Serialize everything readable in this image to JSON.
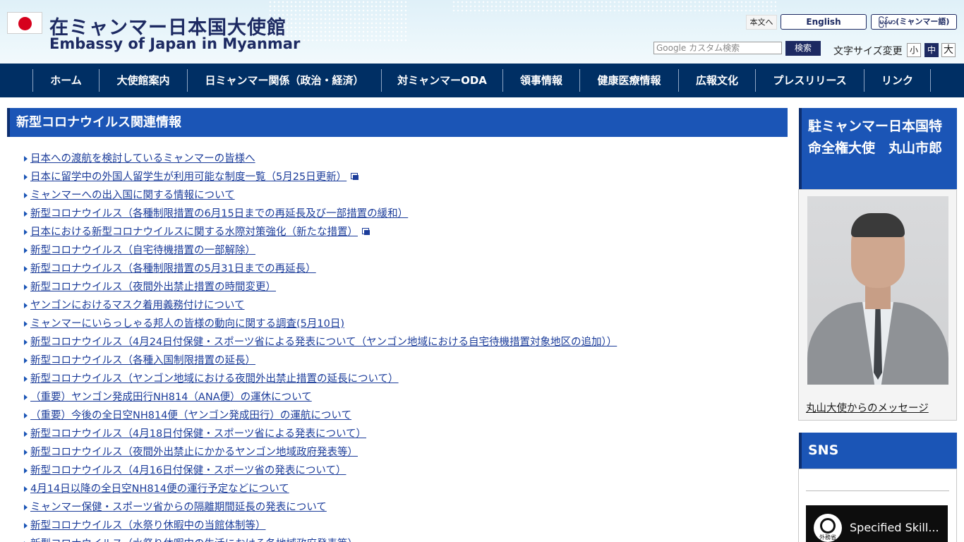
{
  "header": {
    "title_ja": "在ミャンマー日本国大使館",
    "title_en": "Embassy of Japan in Myanmar",
    "skip_link": "本文へ",
    "lang_en": "English",
    "lang_my": "မြန်မာ(ミャンマー語)",
    "search_placeholder": "Google カスタム検索",
    "search_button": "検索",
    "fontsize_label": "文字サイズ変更",
    "fontsize_small": "小",
    "fontsize_medium": "中",
    "fontsize_large": "大"
  },
  "nav": {
    "items": [
      {
        "label": "ホーム"
      },
      {
        "label": "大使館案内"
      },
      {
        "label": "日ミャンマー関係（政治・経済）"
      },
      {
        "label": "対ミャンマーODA"
      },
      {
        "label": "領事情報"
      },
      {
        "label": "健康医療情報"
      },
      {
        "label": "広報文化"
      },
      {
        "label": "プレスリリース"
      },
      {
        "label": "リンク"
      }
    ]
  },
  "main": {
    "heading": "新型コロナウイルス関連情報",
    "news": [
      {
        "text": "日本への渡航を検討しているミャンマーの皆様へ"
      },
      {
        "text": "日本に留学中の外国人留学生が利用可能な制度一覧（5月25日更新）",
        "external": true
      },
      {
        "text": "ミャンマーへの出入国に関する情報について"
      },
      {
        "text": "新型コロナウイルス（各種制限措置の6月15日までの再延長及び一部措置の緩和）"
      },
      {
        "text": "日本における新型コロナウイルスに関する水際対策強化（新たな措置）",
        "external": true
      },
      {
        "text": "新型コロナウイルス（自宅待機措置の一部解除）"
      },
      {
        "text": "新型コロナウイルス（各種制限措置の5月31日までの再延長）"
      },
      {
        "text": "新型コロナウイルス（夜間外出禁止措置の時間変更）"
      },
      {
        "text": "ヤンゴンにおけるマスク着用義務付けについて"
      },
      {
        "text": "ミャンマーにいらっしゃる邦人の皆様の動向に関する調査(5月10日)"
      },
      {
        "text": "新型コロナウイルス（4月24日付保健・スポーツ省による発表について（ヤンゴン地域における自宅待機措置対象地区の追加））"
      },
      {
        "text": "新型コロナウイルス（各種入国制限措置の延長）"
      },
      {
        "text": "新型コロナウイルス（ヤンゴン地域における夜間外出禁止措置の延長について）"
      },
      {
        "text": "（重要）ヤンゴン発成田行NH814（ANA便）の運休について"
      },
      {
        "text": "（重要）今後の全日空NH814便（ヤンゴン発成田行）の運航について"
      },
      {
        "text": "新型コロナウイルス（4月18日付保健・スポーツ省による発表について）"
      },
      {
        "text": "新型コロナウイルス（夜間外出禁止にかかるヤンゴン地域政府発表等）"
      },
      {
        "text": "新型コロナウイルス（4月16日付保健・スポーツ省の発表について）"
      },
      {
        "text": "4月14日以降の全日空NH814便の運行予定などについて"
      },
      {
        "text": "ミャンマー保健・スポーツ省からの隔離期間延長の発表について"
      },
      {
        "text": "新型コロナウイルス（水祭り休暇中の当館体制等）"
      },
      {
        "text": "新型コロナウイルス（水祭り休暇中の生活における各地域政府発表等）"
      }
    ]
  },
  "sidebar": {
    "ambassador_heading": "駐ミャンマー日本国特命全権大使　丸山市郎",
    "message_link": "丸山大使からのメッセージ",
    "sns_heading": "SNS",
    "video_title": "Specified Skill...",
    "video_logo_text": "外務省"
  },
  "colors": {
    "nav_bg": "#002f64",
    "heading_bg": "#1b55b6",
    "link": "#1b3c9a"
  }
}
